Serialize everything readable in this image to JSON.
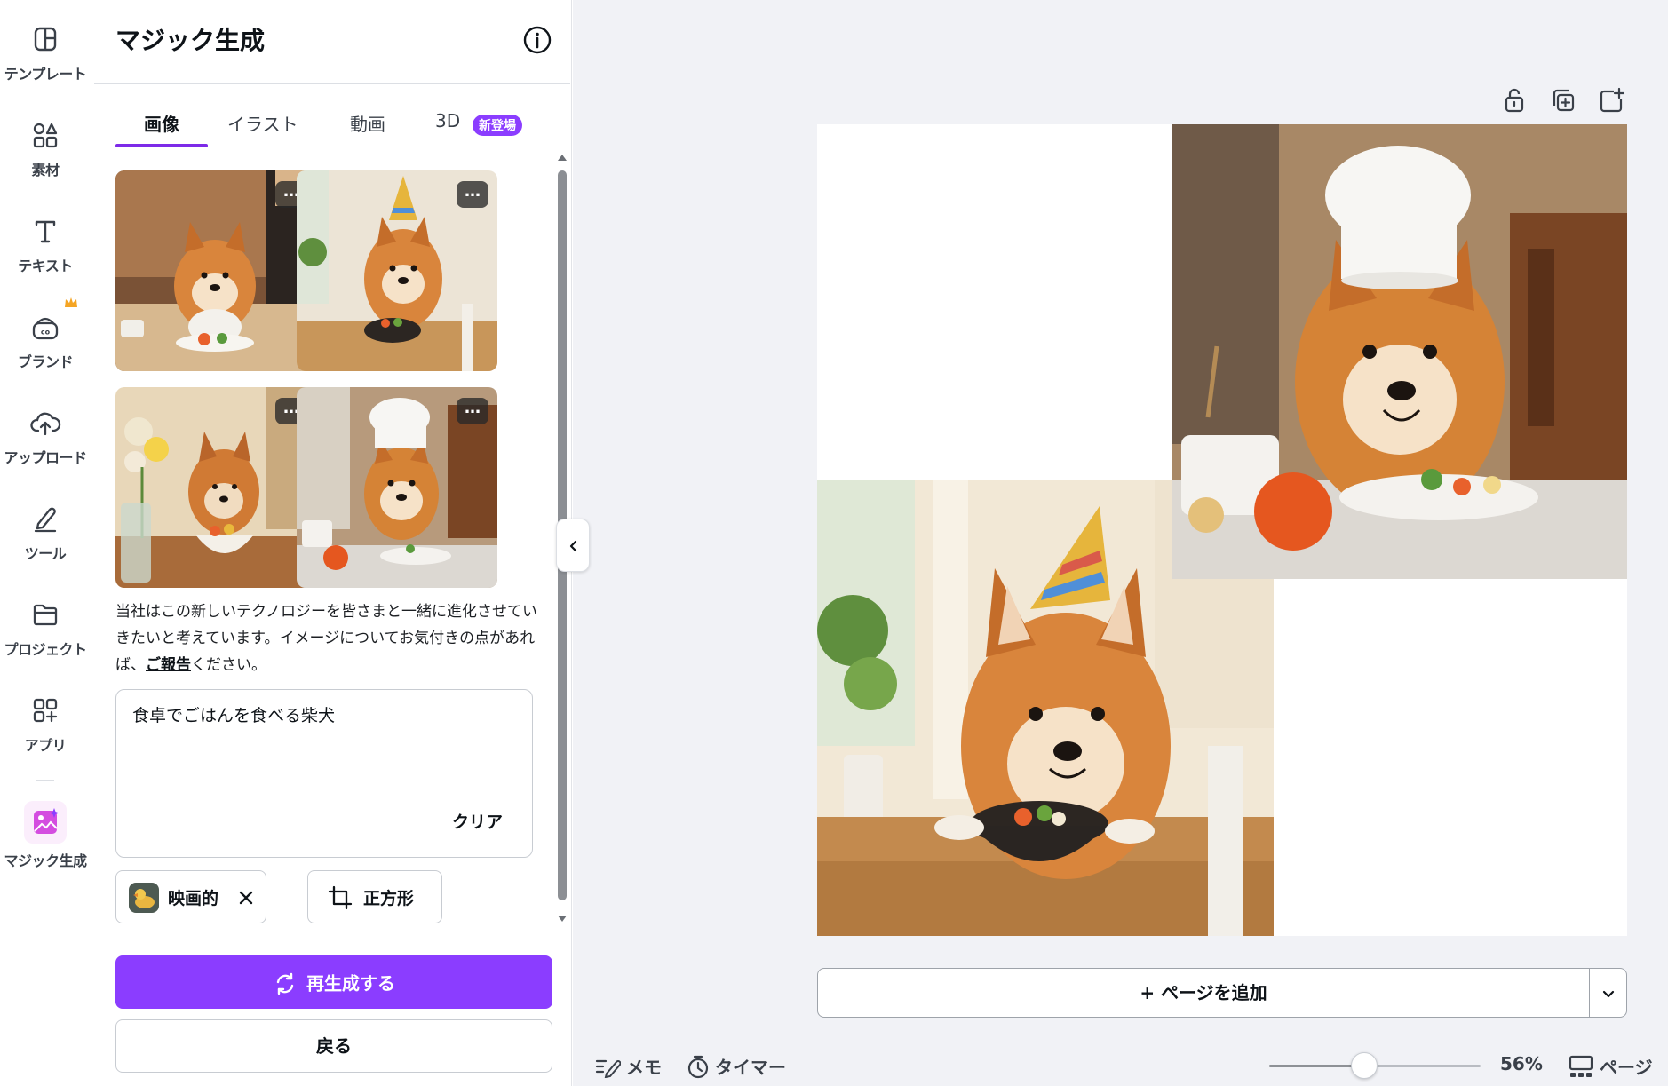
{
  "rail": {
    "items": [
      {
        "label": "テンプレート",
        "icon": "template-icon"
      },
      {
        "label": "素材",
        "icon": "elements-icon"
      },
      {
        "label": "テキスト",
        "icon": "text-icon"
      },
      {
        "label": "ブランド",
        "icon": "brand-icon"
      },
      {
        "label": "アップロード",
        "icon": "upload-icon"
      },
      {
        "label": "ツール",
        "icon": "tools-icon"
      },
      {
        "label": "プロジェクト",
        "icon": "projects-icon"
      },
      {
        "label": "アプリ",
        "icon": "apps-icon"
      },
      {
        "label": "マジック生成",
        "icon": "magic-generate-icon"
      }
    ]
  },
  "panel": {
    "title": "マジック生成",
    "tabs": [
      {
        "label": "画像",
        "active": true
      },
      {
        "label": "イラスト",
        "active": false
      },
      {
        "label": "動画",
        "active": false
      },
      {
        "label": "3D",
        "active": false
      }
    ],
    "new_badge": "新登場",
    "more_label": "…",
    "disclaimer_part1": "当社はこの新しいテクノロジーを皆さまと一緒に進化させていきたいと考えています。イメージについてお気付きの点があれば、",
    "disclaimer_link": "ご報告",
    "disclaimer_part2": "ください。",
    "prompt": "食卓でごはんを食べる柴犬",
    "clear_label": "クリア",
    "style_chip": "映画的",
    "aspect_chip": "正方形",
    "regenerate_label": "再生成する",
    "back_label": "戻る"
  },
  "editor": {
    "add_page_label": "+ ページを追加",
    "notes_label": "メモ",
    "timer_label": "タイマー",
    "zoom_value": "56%",
    "zoom_fraction": 0.45,
    "pages_label": "ページ"
  },
  "colors": {
    "accent": "#8b3dff",
    "canvas_bg": "#f1f2f6",
    "crown": "#f5a524"
  }
}
